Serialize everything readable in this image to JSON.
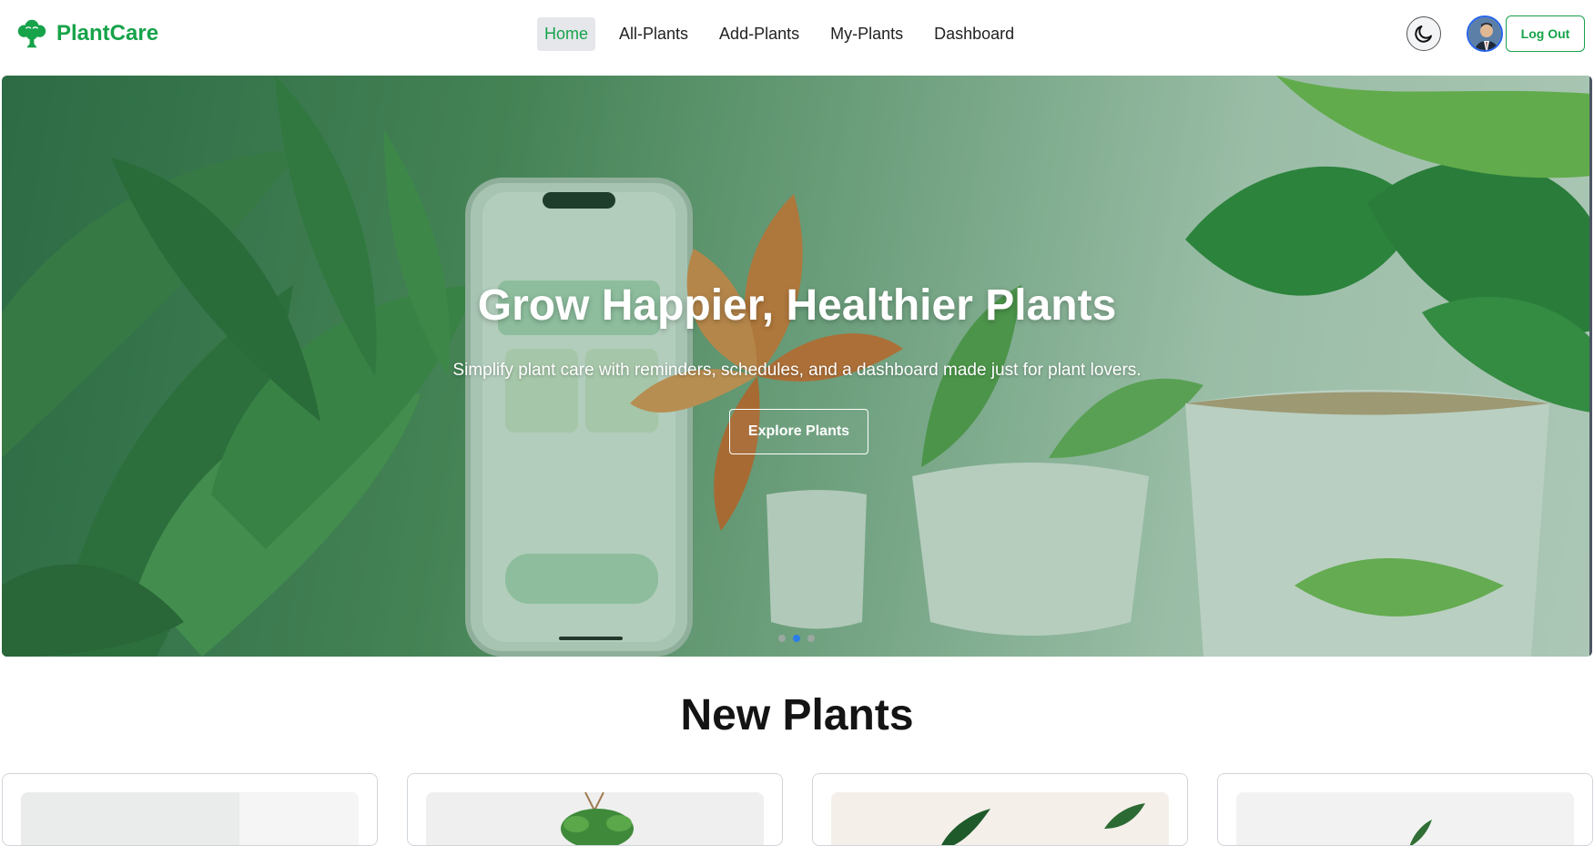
{
  "brand": {
    "name": "PlantCare",
    "color": "#16a34a"
  },
  "nav": {
    "items": [
      {
        "label": "Home",
        "active": true
      },
      {
        "label": "All-Plants",
        "active": false
      },
      {
        "label": "Add-Plants",
        "active": false
      },
      {
        "label": "My-Plants",
        "active": false
      },
      {
        "label": "Dashboard",
        "active": false
      }
    ],
    "theme_toggle_icon": "moon-icon",
    "logout_label": "Log Out"
  },
  "hero": {
    "title": "Grow Happier, Healthier Plants",
    "subtitle": "Simplify plant care with reminders, schedules, and a dashboard made just for plant lovers.",
    "cta_label": "Explore Plants",
    "slide_count": 3,
    "active_slide": 2,
    "active_dot_color": "#2a7ee8"
  },
  "new_plants": {
    "title": "New Plants",
    "card_count": 4
  }
}
